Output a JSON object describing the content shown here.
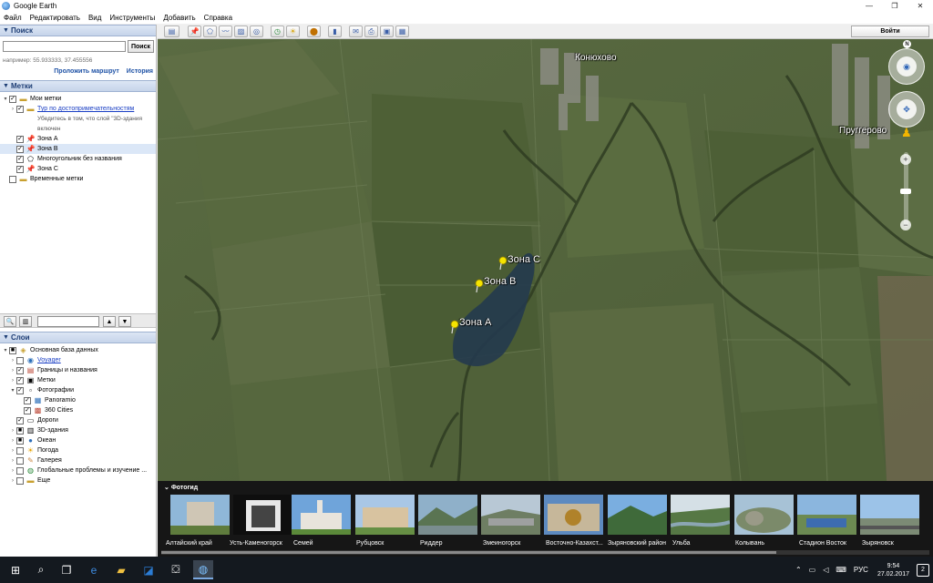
{
  "app": {
    "title": "Google Earth"
  },
  "menu": [
    "Файл",
    "Редактировать",
    "Вид",
    "Инструменты",
    "Добавить",
    "Справка"
  ],
  "search": {
    "header": "Поиск",
    "button": "Поиск",
    "input_value": "",
    "hint": "например: 55.933333, 37.455556",
    "link_route": "Проложить маршрут",
    "link_history": "История"
  },
  "places": {
    "header": "Метки",
    "my_places": "Мои метки",
    "tour": "Тур по достопримечательностям",
    "tour_note_1": "Убедитесь в том, что слой \"3D-здания",
    "tour_note_2": "включен",
    "zone_a": "Зона А",
    "zone_b": "Зона В",
    "polygon": "Многоугольник без названия",
    "zone_c": "Зона С",
    "temp": "Временные метки"
  },
  "layers": {
    "header": "Слои",
    "items": [
      "Основная база данных",
      "Voyager",
      "Границы и названия",
      "Метки",
      "Фотографии",
      "Panoramio",
      "360 Cities",
      "Дороги",
      "3D-здания",
      "Океан",
      "Погода",
      "Галерея",
      "Глобальные проблемы и изучение ...",
      "Еще"
    ]
  },
  "toolbar": {
    "signin": "Войти"
  },
  "map": {
    "towns": [
      "Конюхово",
      "Пруггерово"
    ],
    "pins": [
      "Зона С",
      "Зона В",
      "Зона А"
    ]
  },
  "photoguide": {
    "title": "Фотогид",
    "captions": [
      "Алтайский край",
      "Усть-Каменогорск",
      "Семей",
      "Рубцовск",
      "Риддер",
      "Змеиногорск",
      "Восточно-Казахст...",
      "Зыряновский район",
      "Ульба",
      "Колывань",
      "Стадион Восток",
      "Зыряновск"
    ]
  },
  "taskbar": {
    "lang": "РУС",
    "time": "9:54",
    "date": "27.02.2017",
    "notifications": "2"
  },
  "colors": {
    "accent": "#3167b8",
    "pin": "#f5e400",
    "panel_header": "#c6d4ea",
    "taskbar": "#14191f"
  }
}
